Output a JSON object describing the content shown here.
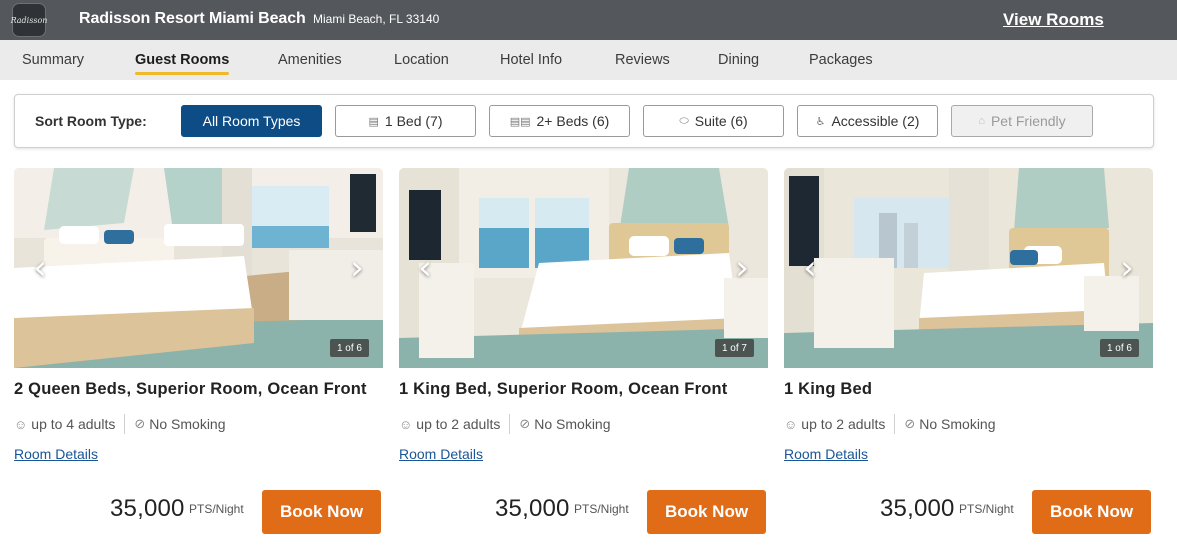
{
  "header": {
    "logo_text": "Radisson",
    "hotel_name": "Radisson Resort Miami Beach",
    "address": "Miami Beach, FL 33140",
    "view_rooms_label": "View Rooms"
  },
  "tabs": [
    {
      "label": "Summary",
      "active": false
    },
    {
      "label": "Guest Rooms",
      "active": true
    },
    {
      "label": "Amenities",
      "active": false
    },
    {
      "label": "Location",
      "active": false
    },
    {
      "label": "Hotel Info",
      "active": false
    },
    {
      "label": "Reviews",
      "active": false
    },
    {
      "label": "Dining",
      "active": false
    },
    {
      "label": "Packages",
      "active": false
    }
  ],
  "filters": {
    "label": "Sort Room Type:",
    "buttons": [
      {
        "label": "All Room Types",
        "icon": "",
        "state": "selected"
      },
      {
        "label": "1 Bed (7)",
        "icon": "bed-icon",
        "state": "normal"
      },
      {
        "label": "2+ Beds (6)",
        "icon": "two-beds-icon",
        "state": "normal"
      },
      {
        "label": "Suite (6)",
        "icon": "sofa-icon",
        "state": "normal"
      },
      {
        "label": "Accessible (2)",
        "icon": "wheelchair-icon",
        "state": "normal"
      },
      {
        "label": "Pet Friendly",
        "icon": "dog-icon",
        "state": "disabled"
      }
    ]
  },
  "rooms": [
    {
      "title": "2 Queen Beds, Superior Room, Ocean Front",
      "occupancy": "up to 4 adults",
      "smoking": "No Smoking",
      "details_label": "Room Details",
      "photo_counter": "1 of 6",
      "price": "35,000",
      "price_unit": "PTS/Night",
      "book_label": "Book Now"
    },
    {
      "title": "1 King Bed, Superior Room, Ocean Front",
      "occupancy": "up to 2 adults",
      "smoking": "No Smoking",
      "details_label": "Room Details",
      "photo_counter": "1 of 7",
      "price": "35,000",
      "price_unit": "PTS/Night",
      "book_label": "Book Now"
    },
    {
      "title": "1 King Bed",
      "occupancy": "up to 2 adults",
      "smoking": "No Smoking",
      "details_label": "Room Details",
      "photo_counter": "1 of 6",
      "price": "35,000",
      "price_unit": "PTS/Night",
      "book_label": "Book Now"
    }
  ],
  "colors": {
    "topbar": "#54575b",
    "tab_bar": "#ebebeb",
    "active_tab_underline": "#f0b92a",
    "filter_selected": "#0e4c86",
    "book_button": "#e16c17",
    "link": "#1a5597"
  }
}
